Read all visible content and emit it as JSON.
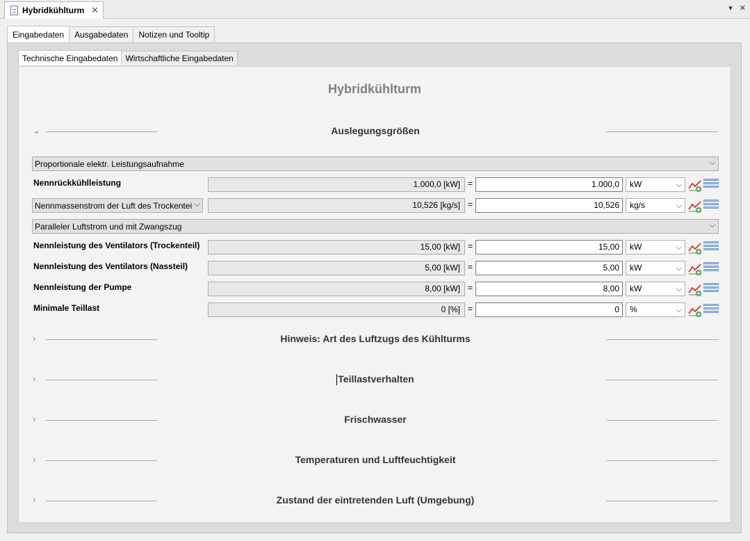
{
  "editor": {
    "tab_title": "Hybridkühlturm",
    "close_glyph": "✕",
    "menu_glyph": "▾",
    "window_close_glyph": "✕"
  },
  "outer_tabs": [
    {
      "label": "Eingabedaten",
      "active": true
    },
    {
      "label": "Ausgabedaten",
      "active": false
    },
    {
      "label": "Notizen und Tooltip",
      "active": false
    }
  ],
  "inner_tabs": [
    {
      "label": "Technische Eingabedaten",
      "active": true
    },
    {
      "label": "Wirtschaftliche Eingabedaten",
      "active": false
    }
  ],
  "page_title": "Hybridkühlturm",
  "sections": {
    "auslegung": "Auslegungsgrößen",
    "hinweis": "Hinweis: Art des Luftzugs des Kühlturms",
    "teillast": "Teillastverhalten",
    "frischwasser": "Frischwasser",
    "temperaturen": "Temperaturen und Luftfeuchtigkeit",
    "zustand": "Zustand der eintretenden Luft (Umgebung)"
  },
  "selects": {
    "leistungsaufnahme": "Proportionale elektr. Leistungsaufnahme",
    "luftstrom": "Paralleler Luftstrom und mit Zwangszug"
  },
  "rows": {
    "nennrueck": {
      "label": "Nennrückkühlleistung",
      "readonly": "1.000,0 [kW]",
      "value": "1.000,0",
      "unit": "kW"
    },
    "massenstrom": {
      "label": "Nennmassenstrom der Luft des Trockenteils",
      "readonly": "10,526 [kg/s]",
      "value": "10,526",
      "unit": "kg/s"
    },
    "vent_trocken": {
      "label": "Nennleistung des Ventilators (Trockenteil)",
      "readonly": "15,00 [kW]",
      "value": "15,00",
      "unit": "kW"
    },
    "vent_nass": {
      "label": "Nennleistung des Ventilators (Nassteil)",
      "readonly": "5,00 [kW]",
      "value": "5,00",
      "unit": "kW"
    },
    "pumpe": {
      "label": "Nennleistung der Pumpe",
      "readonly": "8,00 [kW]",
      "value": "8,00",
      "unit": "kW"
    },
    "teillast": {
      "label": "Minimale Teillast",
      "readonly": "0 [%]",
      "value": "0",
      "unit": "%"
    }
  },
  "glyphs": {
    "equals": "=",
    "chevron_down": "⌵",
    "chevron_right": "›",
    "chevron_expanded": "⌄"
  }
}
